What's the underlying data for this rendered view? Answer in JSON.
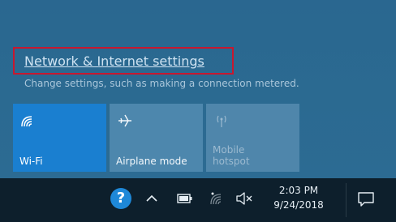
{
  "flyout": {
    "settings_link": "Network & Internet settings",
    "settings_desc": "Change settings, such as making a connection metered.",
    "tiles": [
      {
        "label": "Wi-Fi",
        "icon": "wifi-icon",
        "active": true
      },
      {
        "label": "Airplane mode",
        "icon": "airplane-icon",
        "active": false
      },
      {
        "label": "Mobile\nhotspot",
        "label_line1": "Mobile",
        "label_line2": "hotspot",
        "icon": "mobile-hotspot-icon",
        "active": false,
        "disabled": true
      }
    ]
  },
  "taskbar": {
    "help_glyph": "?",
    "time": "2:03 PM",
    "date": "9/24/2018",
    "icons": [
      "help-icon",
      "chevron-up-icon",
      "battery-icon",
      "wifi-icon",
      "volume-muted-icon",
      "action-center-icon"
    ]
  },
  "colors": {
    "highlight_box": "#c8182f",
    "wifi_tile_active": "#1a7fd0",
    "flyout_bg": "#2a6790",
    "taskbar_bg": "#0d1f2c"
  }
}
